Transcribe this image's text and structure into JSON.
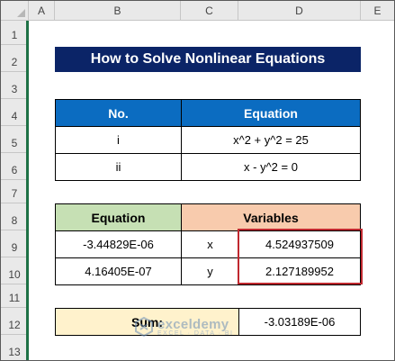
{
  "columns": [
    "A",
    "B",
    "C",
    "D",
    "E"
  ],
  "rows": [
    "1",
    "2",
    "3",
    "4",
    "5",
    "6",
    "7",
    "8",
    "9",
    "10",
    "11",
    "12",
    "13"
  ],
  "title": "How to Solve Nonlinear Equations",
  "equations_table": {
    "headers": [
      "No.",
      "Equation"
    ],
    "rows": [
      {
        "no": "i",
        "equation": "x^2 + y^2 = 25"
      },
      {
        "no": "ii",
        "equation": "x - y^2 = 0"
      }
    ]
  },
  "solver_table": {
    "headers": [
      "Equation",
      "Variables"
    ],
    "rows": [
      {
        "equation": "-3.44829E-06",
        "variable": "x",
        "value": "4.524937509"
      },
      {
        "equation": "4.16405E-07",
        "variable": "y",
        "value": "2.127189952"
      }
    ]
  },
  "sum": {
    "label": "Sum:",
    "value": "-3.03189E-06"
  },
  "watermark": {
    "name": "exceldemy",
    "tagline": "EXCEL · DATA · BI"
  },
  "colors": {
    "title_bg": "#0b2467",
    "header_blue": "#0b6cc1",
    "header_green": "#c6e0b4",
    "header_orange": "#f8cbad",
    "sum_bg": "#fff2cc",
    "highlight_border": "#c0282f",
    "gridline_bar": "#1e7145"
  }
}
